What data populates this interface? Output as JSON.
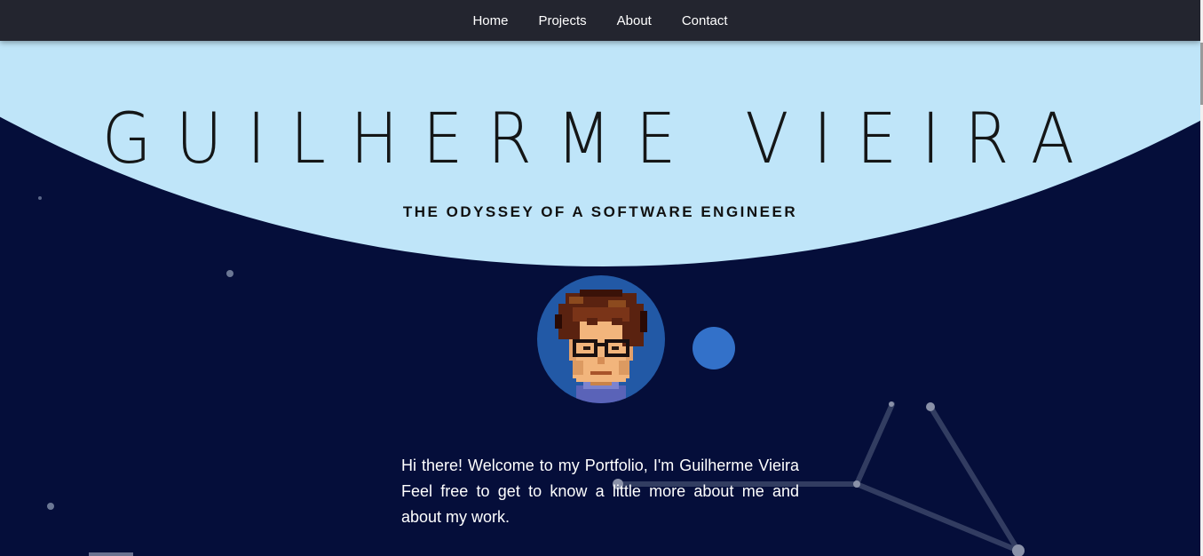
{
  "nav": {
    "items": [
      {
        "label": "Home"
      },
      {
        "label": "Projects"
      },
      {
        "label": "About"
      },
      {
        "label": "Contact"
      }
    ]
  },
  "hero": {
    "title": "GUILHERME VIEIRA",
    "subtitle": "THE ODYSSEY OF A SOFTWARE ENGINEER"
  },
  "intro": {
    "paragraph1": "Hi there! Welcome to my Portfolio, I'm Guilherme Vieira Feel free to get to know a little more about me and about my work."
  },
  "colors": {
    "navbar": "#23252f",
    "sky": "#bfe5f9",
    "space": "#050e3a",
    "avatar_bg": "#2259a6",
    "planet": "#3371c9"
  },
  "icons": {
    "avatar": "pixel-art-avatar-icon",
    "planet": "planet-circle-icon"
  }
}
